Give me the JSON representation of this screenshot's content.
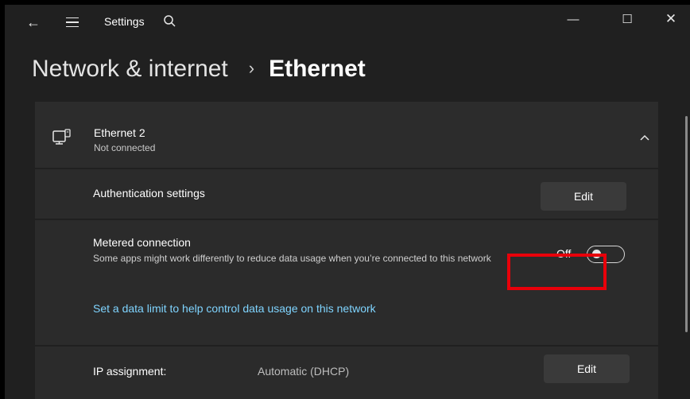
{
  "titlebar": {
    "app_title": "Settings",
    "icons": [
      "back-arrow-icon",
      "hamburger-menu-icon",
      "search-icon",
      "minimize-icon",
      "maximize-icon",
      "close-icon"
    ],
    "back": "←",
    "minimize": "—",
    "maximize": "☐",
    "close": "✕"
  },
  "breadcrumb": {
    "parent": "Network & internet",
    "separator": "›",
    "current": "Ethernet"
  },
  "adapter": {
    "name": "Ethernet 2",
    "status": "Not connected",
    "icon": "ethernet-icon",
    "expanded": true
  },
  "auth": {
    "label": "Authentication settings",
    "button": "Edit"
  },
  "metered": {
    "label": "Metered connection",
    "description": "Some apps might work differently to reduce data usage when you’re connected to this network",
    "toggle_state": "Off",
    "link": "Set a data limit to help control data usage on this network"
  },
  "ip": {
    "label": "IP assignment:",
    "value": "Automatic (DHCP)",
    "button": "Edit"
  },
  "colors": {
    "background": "#202020",
    "card": "#2b2b2b",
    "link": "#7fd4ff",
    "highlight": "#e8000a"
  }
}
